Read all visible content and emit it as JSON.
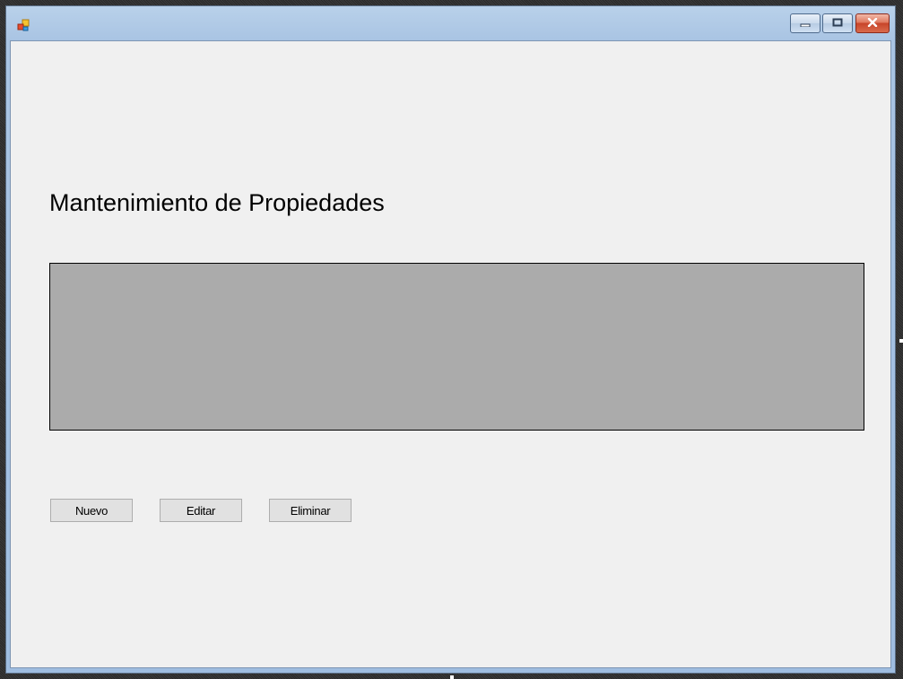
{
  "window": {
    "title": "",
    "icon": "app-form-icon",
    "caption_buttons": [
      "minimize-icon",
      "maximize-icon",
      "close-icon"
    ]
  },
  "form": {
    "title": "Mantenimiento de Propiedades",
    "grid": {
      "rows": [],
      "background": "#ababab"
    },
    "buttons": {
      "new_label": "Nuevo",
      "edit_label": "Editar",
      "delete_label": "Eliminar"
    }
  },
  "colors": {
    "form_background": "#f0f0f0",
    "title_bar": "#b9d1ea",
    "close_button": "#c8452a"
  }
}
